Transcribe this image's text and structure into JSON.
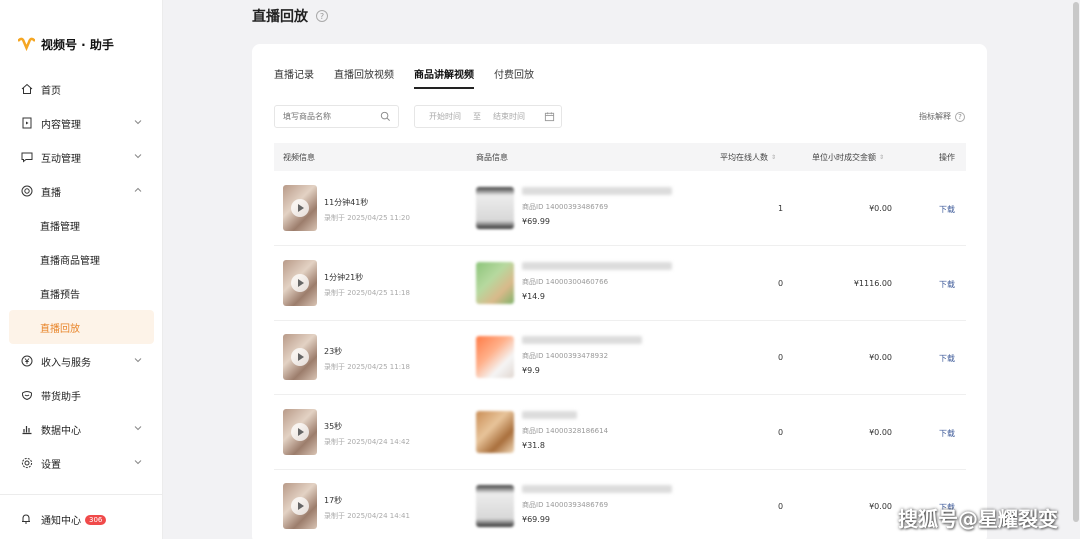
{
  "app": {
    "brand": "视频号 · 助手"
  },
  "sidebar": {
    "items": [
      {
        "label": "首页",
        "icon": "home-icon"
      },
      {
        "label": "内容管理",
        "icon": "content-icon"
      },
      {
        "label": "互动管理",
        "icon": "comment-icon"
      },
      {
        "label": "直播",
        "icon": "live-icon"
      },
      {
        "label": "直播管理"
      },
      {
        "label": "直播商品管理"
      },
      {
        "label": "直播预告"
      },
      {
        "label": "直播回放",
        "active": true
      },
      {
        "label": "收入与服务",
        "icon": "yuan-icon"
      },
      {
        "label": "带货助手",
        "icon": "cart-icon"
      },
      {
        "label": "数据中心",
        "icon": "chart-icon"
      },
      {
        "label": "设置",
        "icon": "gear-icon"
      }
    ],
    "notify": {
      "label": "通知中心",
      "count": "306"
    }
  },
  "page": {
    "title": "直播回放"
  },
  "tabs": [
    "直播记录",
    "直播回放视频",
    "商品讲解视频",
    "付费回放"
  ],
  "active_tab": "商品讲解视频",
  "filters": {
    "search_placeholder": "填写商品名称",
    "start_placeholder": "开始时间",
    "sep": "至",
    "end_placeholder": "结束时间",
    "metric_help": "指标解释"
  },
  "table": {
    "headers": [
      "视频信息",
      "商品信息",
      "平均在线人数",
      "单位小时成交金额",
      "操作"
    ],
    "rows": [
      {
        "duration": "11分钟41秒",
        "recorded": "录制于 2025/04/25 11:20",
        "product_id": "商品ID 14000393486769",
        "price": "¥69.99",
        "online": "1",
        "gmv": "¥0.00",
        "action": "下载"
      },
      {
        "duration": "1分钟21秒",
        "recorded": "录制于 2025/04/25 11:18",
        "product_id": "商品ID 14000300460766",
        "price": "¥14.9",
        "online": "0",
        "gmv": "¥1116.00",
        "action": "下载"
      },
      {
        "duration": "23秒",
        "recorded": "录制于 2025/04/25 11:18",
        "product_id": "商品ID 14000393478932",
        "price": "¥9.9",
        "online": "0",
        "gmv": "¥0.00",
        "action": "下载"
      },
      {
        "duration": "35秒",
        "recorded": "录制于 2025/04/24 14:42",
        "product_id": "商品ID 14000328186614",
        "price": "¥31.8",
        "online": "0",
        "gmv": "¥0.00",
        "action": "下载"
      },
      {
        "duration": "17秒",
        "recorded": "录制于 2025/04/24 14:41",
        "product_id": "商品ID 14000393486769",
        "price": "¥69.99",
        "online": "0",
        "gmv": "¥0.00",
        "action": "下载"
      }
    ]
  },
  "watermark": "搜狐号@星耀裂变",
  "colors": {
    "accent": "#e8852a",
    "active_bg": "#fdf3e8",
    "link": "#3d5a99",
    "badge": "#f04a4a"
  }
}
